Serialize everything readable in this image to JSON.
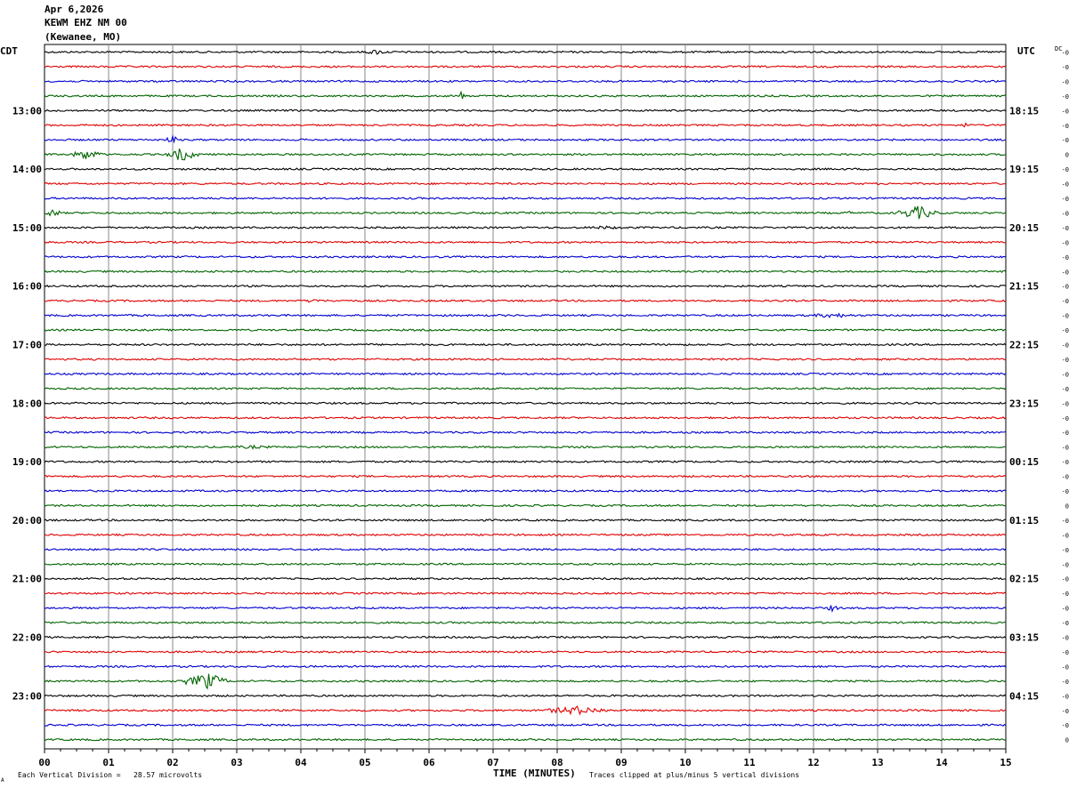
{
  "header": {
    "date": "Apr 6,2026",
    "station": "KEWM EHZ NM 00",
    "location": "(Kewanee, MO)"
  },
  "labels": {
    "left_timezone": "CDT",
    "right_timezone": "UTC",
    "dc": "DC",
    "xaxis_title": "TIME (MINUTES)",
    "scale_note": "Each Vertical Division =   28.57 microvolts",
    "clip_note": "Traces clipped at plus/minus 5 vertical divisions",
    "corner_mark": "A"
  },
  "colors": [
    "#000000",
    "#e00000",
    "#0000d0",
    "#006400"
  ],
  "chart_data": {
    "type": "line",
    "title": "KEWM EHZ NM 00 (Kewanee, MO) Apr 6,2026",
    "xlabel": "TIME (MINUTES)",
    "ylabel": "",
    "xlim": [
      0,
      15
    ],
    "x_ticks": [
      "00",
      "01",
      "02",
      "03",
      "04",
      "05",
      "06",
      "07",
      "08",
      "09",
      "10",
      "11",
      "12",
      "13",
      "14",
      "15"
    ],
    "minutes_per_line": 15,
    "line_count": 48,
    "left_hour_labels": [
      "13:00",
      "14:00",
      "15:00",
      "16:00",
      "17:00",
      "18:00",
      "19:00",
      "20:00",
      "21:00",
      "22:00",
      "23:00"
    ],
    "right_hour_labels": [
      "18:15",
      "19:15",
      "20:15",
      "21:15",
      "22:15",
      "23:15",
      "00:15",
      "01:15",
      "02:15",
      "03:15",
      "04:15"
    ],
    "first_labeled_line": 4,
    "dc_offsets": [
      "-0",
      "-0",
      "-0",
      "-0",
      "-0",
      "-0",
      "-0",
      "0",
      "-0",
      "-0",
      "-0",
      "-0",
      "-0",
      "-0",
      "-0",
      "-0",
      "-0",
      "-0",
      "-0",
      "-0",
      "-0",
      "-0",
      "-0",
      "-0",
      "-0",
      "-0",
      "-0",
      "-0",
      "-0",
      "-0",
      "-0",
      "0",
      "-0",
      "-0",
      "-0",
      "-0",
      "-0",
      "-0",
      "-0",
      "-0",
      "-0",
      "-0",
      "-0",
      "-0",
      "-0",
      "-0",
      "-0",
      "0"
    ],
    "events": [
      {
        "line": 0,
        "start_min": 5.0,
        "end_min": 5.35,
        "amplitude": 3
      },
      {
        "line": 3,
        "start_min": 6.45,
        "end_min": 6.55,
        "amplitude": 6
      },
      {
        "line": 5,
        "start_min": 14.3,
        "end_min": 14.45,
        "amplitude": 3
      },
      {
        "line": 6,
        "start_min": 1.9,
        "end_min": 2.1,
        "amplitude": 5
      },
      {
        "line": 7,
        "start_min": 0.4,
        "end_min": 0.9,
        "amplitude": 6
      },
      {
        "line": 7,
        "start_min": 1.9,
        "end_min": 2.4,
        "amplitude": 8
      },
      {
        "line": 11,
        "start_min": 0.0,
        "end_min": 0.25,
        "amplitude": 5
      },
      {
        "line": 11,
        "start_min": 12.5,
        "end_min": 12.6,
        "amplitude": 3
      },
      {
        "line": 11,
        "start_min": 13.3,
        "end_min": 13.95,
        "amplitude": 8
      },
      {
        "line": 12,
        "start_min": 8.5,
        "end_min": 9.0,
        "amplitude": 2
      },
      {
        "line": 17,
        "start_min": 4.1,
        "end_min": 4.3,
        "amplitude": 3
      },
      {
        "line": 18,
        "start_min": 12.0,
        "end_min": 12.6,
        "amplitude": 3
      },
      {
        "line": 27,
        "start_min": 3.0,
        "end_min": 3.5,
        "amplitude": 2
      },
      {
        "line": 38,
        "start_min": 12.2,
        "end_min": 12.4,
        "amplitude": 4
      },
      {
        "line": 43,
        "start_min": 2.2,
        "end_min": 2.85,
        "amplitude": 10
      },
      {
        "line": 45,
        "start_min": 7.8,
        "end_min": 8.8,
        "amplitude": 5
      }
    ]
  }
}
